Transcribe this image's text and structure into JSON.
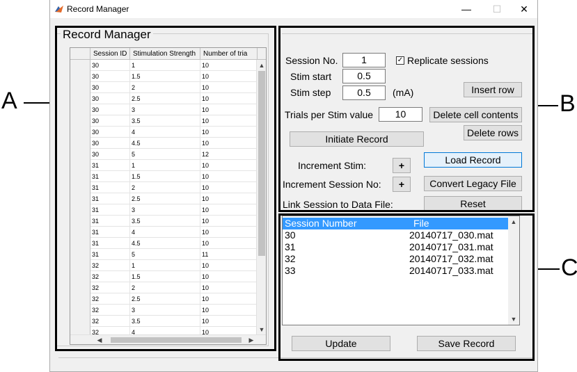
{
  "figure_labels": {
    "a": "A",
    "b": "B",
    "c": "C"
  },
  "window": {
    "title": "Record Manager",
    "minimize": "—",
    "maximize": "☐",
    "close": "✕"
  },
  "panel_a": {
    "title": "Record Manager",
    "columns": [
      "Session ID",
      "Stimulation Strength",
      "Number of tria"
    ],
    "rows": [
      [
        "30",
        "1",
        "10"
      ],
      [
        "30",
        "1.5",
        "10"
      ],
      [
        "30",
        "2",
        "10"
      ],
      [
        "30",
        "2.5",
        "10"
      ],
      [
        "30",
        "3",
        "10"
      ],
      [
        "30",
        "3.5",
        "10"
      ],
      [
        "30",
        "4",
        "10"
      ],
      [
        "30",
        "4.5",
        "10"
      ],
      [
        "30",
        "5",
        "12"
      ],
      [
        "31",
        "1",
        "10"
      ],
      [
        "31",
        "1.5",
        "10"
      ],
      [
        "31",
        "2",
        "10"
      ],
      [
        "31",
        "2.5",
        "10"
      ],
      [
        "31",
        "3",
        "10"
      ],
      [
        "31",
        "3.5",
        "10"
      ],
      [
        "31",
        "4",
        "10"
      ],
      [
        "31",
        "4.5",
        "10"
      ],
      [
        "31",
        "5",
        "11"
      ],
      [
        "32",
        "1",
        "10"
      ],
      [
        "32",
        "1.5",
        "10"
      ],
      [
        "32",
        "2",
        "10"
      ],
      [
        "32",
        "2.5",
        "10"
      ],
      [
        "32",
        "3",
        "10"
      ],
      [
        "32",
        "3.5",
        "10"
      ],
      [
        "32",
        "4",
        "10"
      ]
    ],
    "scroll_up": "▲",
    "scroll_down": "▼",
    "scroll_left": "◀",
    "scroll_right": "▶"
  },
  "panel_b": {
    "session_no_label": "Session No.",
    "session_no_value": "1",
    "replicate_label": "Replicate sessions",
    "replicate_checked": "✓",
    "stim_start_label": "Stim start",
    "stim_start_value": "0.5",
    "stim_step_label": "Stim step",
    "stim_step_value": "0.5",
    "unit": "(mA)",
    "insert_row": "Insert row",
    "trials_label": "Trials per Stim value",
    "trials_value": "10",
    "delete_cell": "Delete cell contents",
    "delete_rows": "Delete rows",
    "initiate_record": "Initiate Record",
    "increment_stim_label": "Increment Stim:",
    "increment_stim_btn": "+",
    "load_record": "Load Record",
    "increment_session_label": "Increment Session No:",
    "increment_session_btn": "+",
    "convert_legacy": "Convert Legacy File",
    "link_session_label": "Link Session to Data File:",
    "reset": "Reset"
  },
  "panel_c": {
    "headers": [
      "Session Number",
      "File"
    ],
    "rows": [
      [
        "30",
        "20140717_030.mat"
      ],
      [
        "31",
        "20140717_031.mat"
      ],
      [
        "32",
        "20140717_032.mat"
      ],
      [
        "33",
        "20140717_033.mat"
      ]
    ],
    "update": "Update",
    "save_record": "Save Record"
  }
}
